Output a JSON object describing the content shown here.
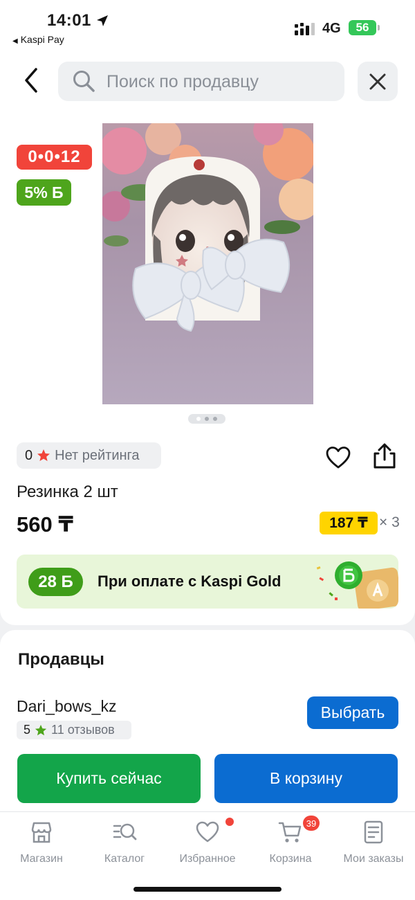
{
  "status_bar": {
    "time": "14:01",
    "back_app": "Kaspi Pay",
    "network": "4G",
    "battery": "56"
  },
  "header": {
    "search_placeholder": "Поиск по продавцу"
  },
  "product": {
    "timer": "0•0•12",
    "bonus_badge": "5% Б",
    "rating_value": "0",
    "rating_text": "Нет рейтинга",
    "title": "Резинка 2 шт",
    "price": "560 ₸",
    "installment_price": "187 ₸",
    "installment_months": "× 3",
    "image_dots": 3,
    "active_dot": 1
  },
  "kaspi_gold": {
    "bonus": "28 Б",
    "text": "При оплате с Kaspi Gold"
  },
  "sellers": {
    "heading": "Продавцы",
    "items": [
      {
        "name": "Dari_bows_kz",
        "rating": "5",
        "reviews": "11 отзывов",
        "select_label": "Выбрать"
      }
    ]
  },
  "actions": {
    "buy_now": "Купить сейчас",
    "add_to_cart": "В корзину"
  },
  "tab_bar": {
    "items": [
      {
        "label": "Магазин",
        "icon": "store-icon"
      },
      {
        "label": "Каталог",
        "icon": "catalog-search-icon"
      },
      {
        "label": "Избранное",
        "icon": "heart-icon"
      },
      {
        "label": "Корзина",
        "icon": "cart-icon"
      },
      {
        "label": "Мои заказы",
        "icon": "orders-icon"
      }
    ],
    "cart_count": "39"
  },
  "colors": {
    "primary_blue": "#0b6cd1",
    "buy_green": "#13a54a",
    "timer_red": "#f1443a",
    "bonus_green": "#4ea51c",
    "installment_yellow": "#ffd400"
  }
}
